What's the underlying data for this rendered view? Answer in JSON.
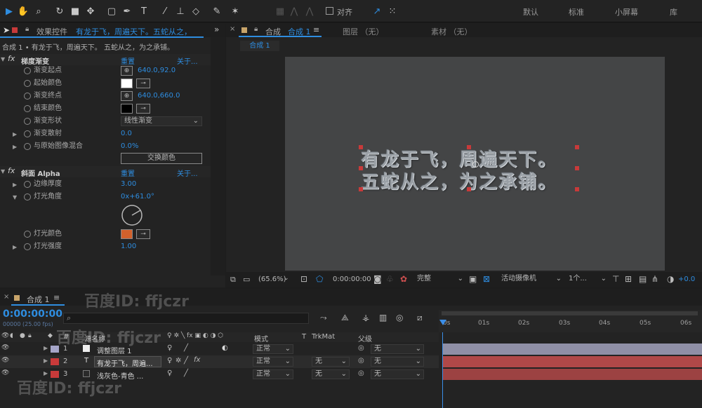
{
  "toolbar": {
    "snap_label": "对齐",
    "workspaces": [
      "默认",
      "标准",
      "小屏幕",
      "库"
    ]
  },
  "effect_panel": {
    "title_prefix": "效果控件",
    "title_layer": "有龙于飞，周遍天下。五蛇从之，",
    "subtitle": "合成 1 • 有龙于飞，周遍天下。 五蛇从之，为之承铺。",
    "effects": [
      {
        "name": "梯度渐变",
        "reset": "重置",
        "about": "关于...",
        "props": [
          {
            "label": "渐变起点",
            "value": "640.0,92.0"
          },
          {
            "label": "起始颜色",
            "value": ""
          },
          {
            "label": "渐变终点",
            "value": "640.0,660.0"
          },
          {
            "label": "结束颜色",
            "value": ""
          },
          {
            "label": "渐变形状",
            "value": "线性渐变"
          },
          {
            "label": "渐变散射",
            "value": "0.0"
          },
          {
            "label": "与原始图像混合",
            "value": "0.0%"
          }
        ],
        "swap_button": "交换颜色"
      },
      {
        "name": "斜面 Alpha",
        "reset": "重置",
        "about": "关于...",
        "props": [
          {
            "label": "边缘厚度",
            "value": "3.00"
          },
          {
            "label": "灯光角度",
            "value": "0x+61.0°"
          },
          {
            "label": "灯光颜色",
            "value": ""
          },
          {
            "label": "灯光强度",
            "value": "1.00"
          }
        ]
      }
    ],
    "colors": {
      "start": "#ffffff",
      "end": "#000000",
      "light": "#d2612c"
    }
  },
  "comp_panel": {
    "tab_comp": "合成",
    "tab_comp_name": "合成 1",
    "tab_layer": "图层 （无）",
    "tab_footage": "素材 （无）",
    "breadcrumb": "合成 1",
    "text_line1": "有龙于飞，周遍天下。",
    "text_line2": "五蛇从之，为之承铺。",
    "zoom": "(65.6%)",
    "timecode": "0:00:00:00",
    "resolution": "完整",
    "camera": "活动摄像机",
    "views": "1个...",
    "exposure": "+0.0"
  },
  "timeline": {
    "tab": "合成 1",
    "timecode": "0:00:00:00",
    "fps": "00000 (25.00 fps)",
    "search_placeholder": "",
    "col_source": "源名称",
    "col_mode": "模式",
    "col_t": "T",
    "col_trkmat": "TrkMat",
    "col_parent": "父级",
    "ruler": [
      "0s",
      "01s",
      "02s",
      "03s",
      "04s",
      "05s",
      "06s"
    ],
    "layers": [
      {
        "num": "1",
        "name": "调整图层 1",
        "mode": "正常",
        "trkmat": "",
        "parent": "无",
        "label_color": "#a5a5c8"
      },
      {
        "num": "2",
        "name": "有龙于飞，周遍...",
        "mode": "正常",
        "trkmat": "无",
        "parent": "无",
        "label_color": "#c83a3a"
      },
      {
        "num": "3",
        "name": "浅灰色-青色 ...",
        "mode": "正常",
        "trkmat": "无",
        "parent": "无",
        "label_color": "#c83a3a"
      }
    ]
  },
  "watermark": "百度ID: ffjczr"
}
